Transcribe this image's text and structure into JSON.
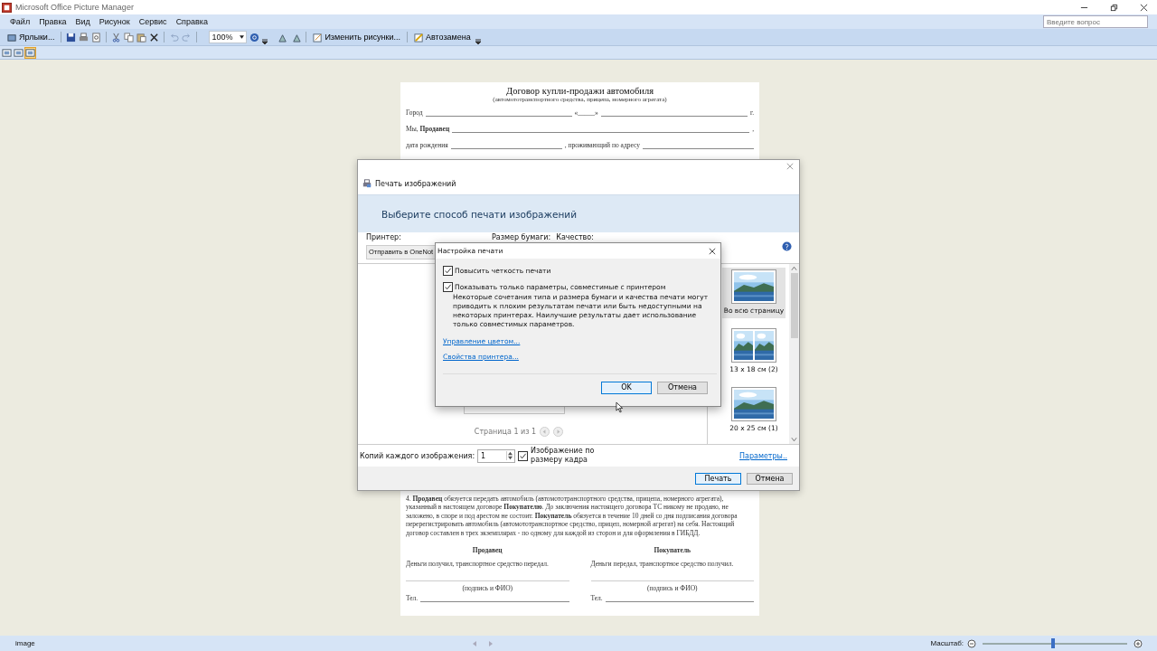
{
  "window": {
    "title": "Microsoft Office Picture Manager"
  },
  "menu": [
    "Файл",
    "Правка",
    "Вид",
    "Рисунок",
    "Сервис",
    "Справка"
  ],
  "help_search": {
    "placeholder": "Введите вопрос"
  },
  "toolbar": {
    "shortcuts": "Ярлыки...",
    "zoom": "100%",
    "edit": "Изменить рисунки...",
    "autocorrect": "Автозамена"
  },
  "view_buttons": [
    {
      "selected": false
    },
    {
      "selected": false
    },
    {
      "selected": true
    }
  ],
  "document": {
    "title": "Договор купли-продажи автомобиля",
    "subtitle": "(автомототранспортного средства, прицепа, номерного агрегата)",
    "lines": [
      {
        "left": "Город",
        "right": "«_____»",
        "end": "г."
      },
      {
        "left": "Мы, **Продавец**",
        "end": ","
      },
      {
        "left": "дата рождения",
        "right": ", проживающий по адресу"
      }
    ],
    "paragraph": "4. **Продавец** обязуется передать автомобиль (автомототранспортного средства, прицепа, номерного агрегата), указанный в настоящем договоре **Покупателю**. До заключения настоящего договора ТС никому не продано, не заложено, в споре и под арестом не состоит. **Покупатель** обязуется в течение 10 дней со дня подписания договора перерегистрировать автомобиль (автомототранспортное средство, прицеп, номерной агрегат) на себя. Настоящий договор составлен в трех экземплярах - по одному для каждой из сторон и для оформления в ГИБДД.",
    "parties": [
      {
        "title": "Продавец",
        "note": "Деньги получил, транспортное средство передал.",
        "sign": "(подпись и ФИО)",
        "phone": "Тел."
      },
      {
        "title": "Покупатель",
        "note": "Деньги передал, транспортное средство получил.",
        "sign": "(подпись и ФИО)",
        "phone": "Тел."
      }
    ]
  },
  "print_dialog": {
    "title": "Печать изображений",
    "heading": "Выберите способ печати изображений",
    "printer_label": "Принтер:",
    "printer_value": "Отправить в OneNot",
    "paper_label": "Размер бумаги:",
    "quality_label": "Качество:",
    "page_info": "Страница 1 из 1",
    "layouts": [
      {
        "label": "Во всю страницу",
        "selected": true
      },
      {
        "label": "13 x 18 см (2)",
        "selected": false
      },
      {
        "label": "20 x 25 см (1)",
        "selected": false
      }
    ],
    "copies_label": "Копий каждого изображения:",
    "copies_value": "1",
    "fit": {
      "label": "Изображение по размеру кадра",
      "checked": true
    },
    "options_link": "Параметры..",
    "buttons": [
      "Печать",
      "Отмена"
    ]
  },
  "settings_dialog": {
    "title": "Настройка печати",
    "options": [
      {
        "label": "Повысить четкость печати",
        "checked": true
      },
      {
        "label": "Показывать только параметры, совместимые с принтером",
        "checked": true,
        "note": "Некоторые сочетания типа и размера бумаги и качества печати могут приводить к плохим результатам печати или быть недоступными на некоторых принтерах. Наилучшие результаты дает использование только совместимых параметров."
      }
    ],
    "links": [
      "Управление цветом...",
      "Свойства принтера..."
    ],
    "buttons": [
      {
        "label": "OK",
        "default": true
      },
      {
        "label": "Отмена",
        "default": false
      }
    ]
  },
  "status_bar": {
    "left": "image",
    "zoom_label": "Масштаб:",
    "zoom": {
      "level": 0.49
    }
  }
}
